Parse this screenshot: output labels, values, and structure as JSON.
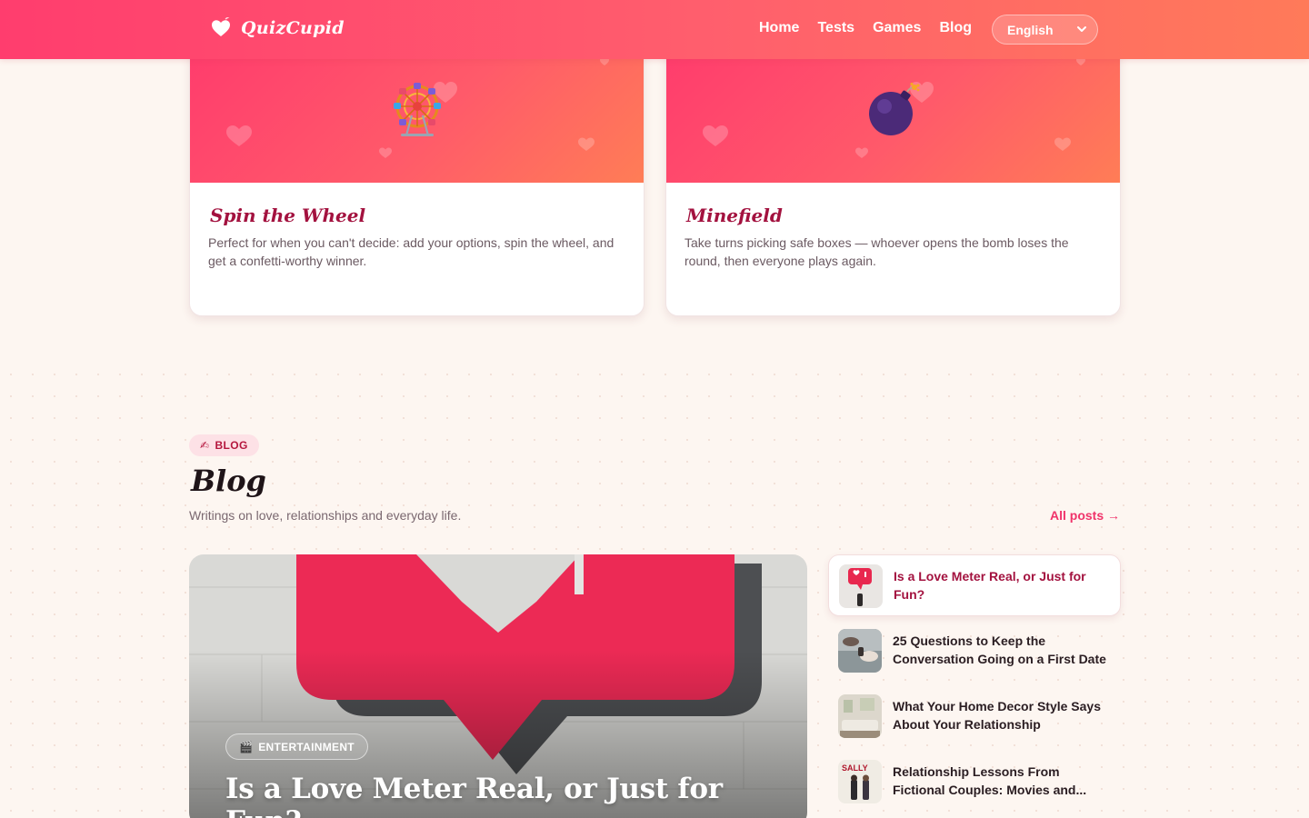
{
  "brand": {
    "name": "QuizCupid"
  },
  "nav": {
    "home": "Home",
    "tests": "Tests",
    "games": "Games",
    "blog": "Blog"
  },
  "language": {
    "selected": "English"
  },
  "games": [
    {
      "title": "Spin the Wheel",
      "description": "Perfect for when you can't decide: add your options, spin the wheel, and get a confetti-worthy winner.",
      "icon": "ferris-wheel-icon"
    },
    {
      "title": "Minefield",
      "description": "Take turns picking safe boxes — whoever opens the bomb loses the round, then everyone plays again.",
      "icon": "bomb-icon"
    }
  ],
  "blog": {
    "badge": "BLOG",
    "badge_icon": "✍",
    "title": "Blog",
    "subtitle": "Writings on love, relationships and everyday life.",
    "all_posts": "All posts →",
    "featured": {
      "category": "ENTERTAINMENT",
      "category_icon": "🎬",
      "title": "Is a Love Meter Real, or Just for Fun?"
    },
    "posts": [
      {
        "title": "Is a Love Meter Real, or Just for Fun?"
      },
      {
        "title": "25 Questions to Keep the Conversation Going on a First Date"
      },
      {
        "title": "What Your Home Decor Style Says About Your Relationship"
      },
      {
        "title": "Relationship Lessons From Fictional Couples: Movies and..."
      }
    ],
    "thumb_text": "SALLY"
  },
  "colors": {
    "accent": "#f0336a",
    "title_crimson": "#a3123f",
    "header_start": "#ff3d6e",
    "header_end": "#ff7a59",
    "background": "#fdf6f1"
  }
}
